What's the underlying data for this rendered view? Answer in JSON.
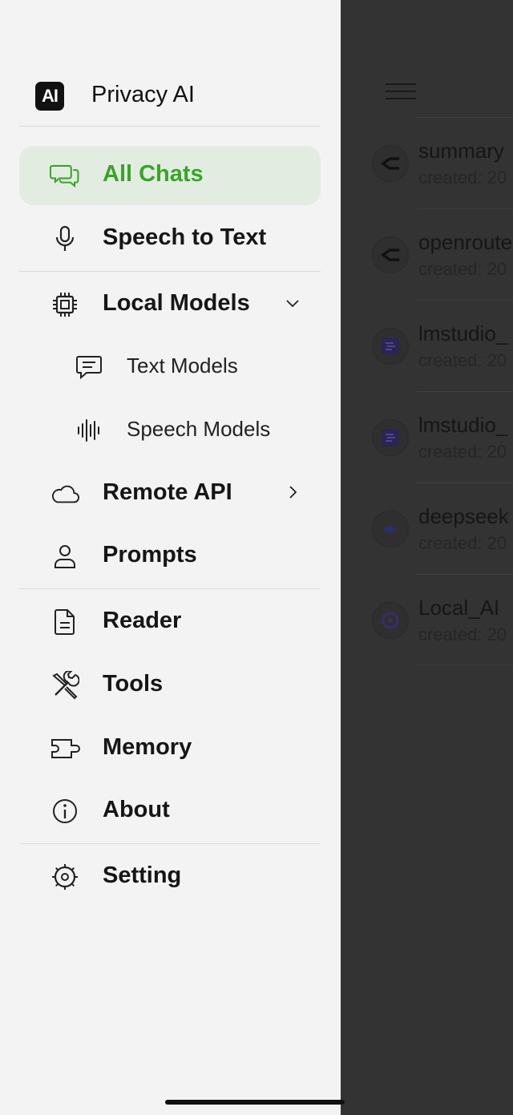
{
  "app": {
    "name": "Privacy AI",
    "logo_text": "AI"
  },
  "nav": {
    "all_chats": "All Chats",
    "speech_to_text": "Speech to Text",
    "local_models": "Local Models",
    "text_models": "Text Models",
    "speech_models": "Speech Models",
    "remote_api": "Remote API",
    "prompts": "Prompts",
    "reader": "Reader",
    "tools": "Tools",
    "memory": "Memory",
    "about": "About",
    "setting": "Setting"
  },
  "chats": [
    {
      "title": "summary",
      "subtitle": "created: 20",
      "icon": "openrouter-icon"
    },
    {
      "title": "openroute",
      "subtitle": "created: 20",
      "icon": "openrouter-icon"
    },
    {
      "title": "lmstudio_",
      "subtitle": "created: 20",
      "icon": "lmstudio-icon"
    },
    {
      "title": "lmstudio_",
      "subtitle": "created: 20",
      "icon": "lmstudio-icon"
    },
    {
      "title": "deepseek",
      "subtitle": "created: 20",
      "icon": "deepseek-icon"
    },
    {
      "title": "Local_AI",
      "subtitle": "created: 20",
      "icon": "local-ai-icon"
    }
  ],
  "colors": {
    "accent": "#3aa42a",
    "active_bg": "#e2ece1",
    "drawer_bg": "#f3f3f3",
    "overlay": "#333333"
  }
}
